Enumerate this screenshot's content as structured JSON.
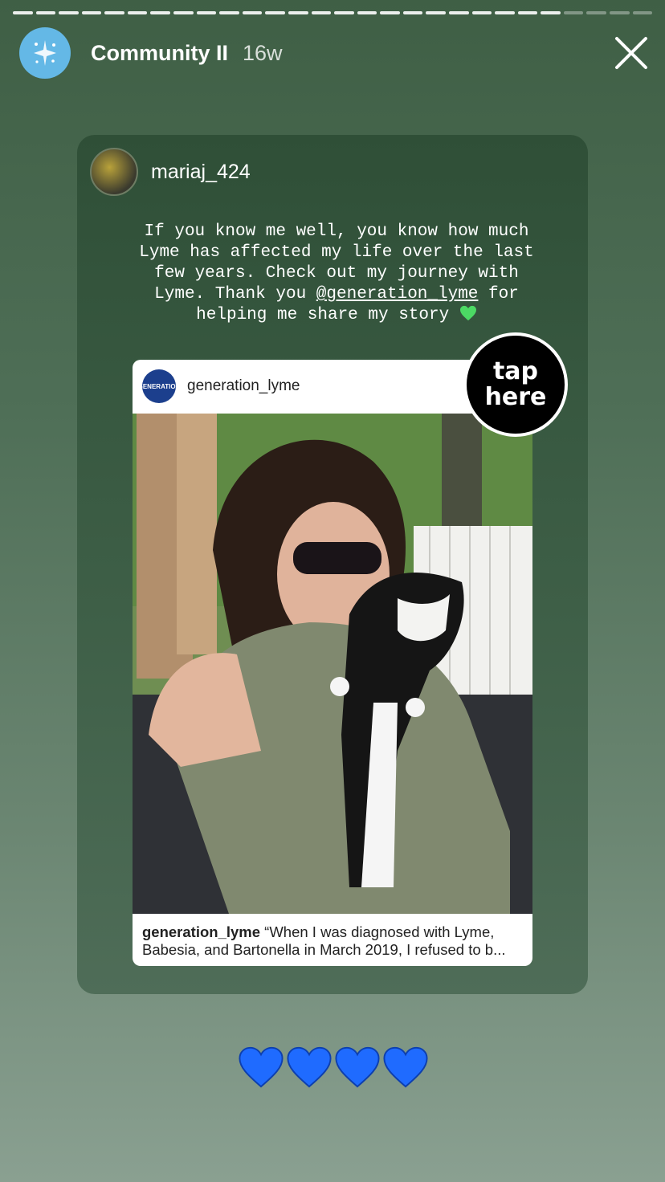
{
  "progress": {
    "total_segments": 28,
    "completed_segments": 24
  },
  "header": {
    "title": "Community II",
    "time": "16w"
  },
  "shared_story": {
    "author": "mariaj_424",
    "caption_lines": [
      "If you know me well, you know how much",
      "Lyme has affected my life over the last",
      "few years. Check out my journey with"
    ],
    "caption_pre": "Lyme. Thank you ",
    "mention": "@generation_lyme",
    "caption_post": " for",
    "caption_last": "helping me share my story"
  },
  "post": {
    "username": "generation_lyme",
    "logo_text": "GENERATION",
    "caption_user": "generation_lyme",
    "caption_text": " “When I was diagnosed with Lyme, Babesia, and Bartonella in March 2019, I refused to b..."
  },
  "sticker": {
    "line1": "tap",
    "line2": "here"
  },
  "colors": {
    "heart_blue": "#1f6bff",
    "heart_green": "#4cd964",
    "avatar_blue": "#64b8e6"
  }
}
